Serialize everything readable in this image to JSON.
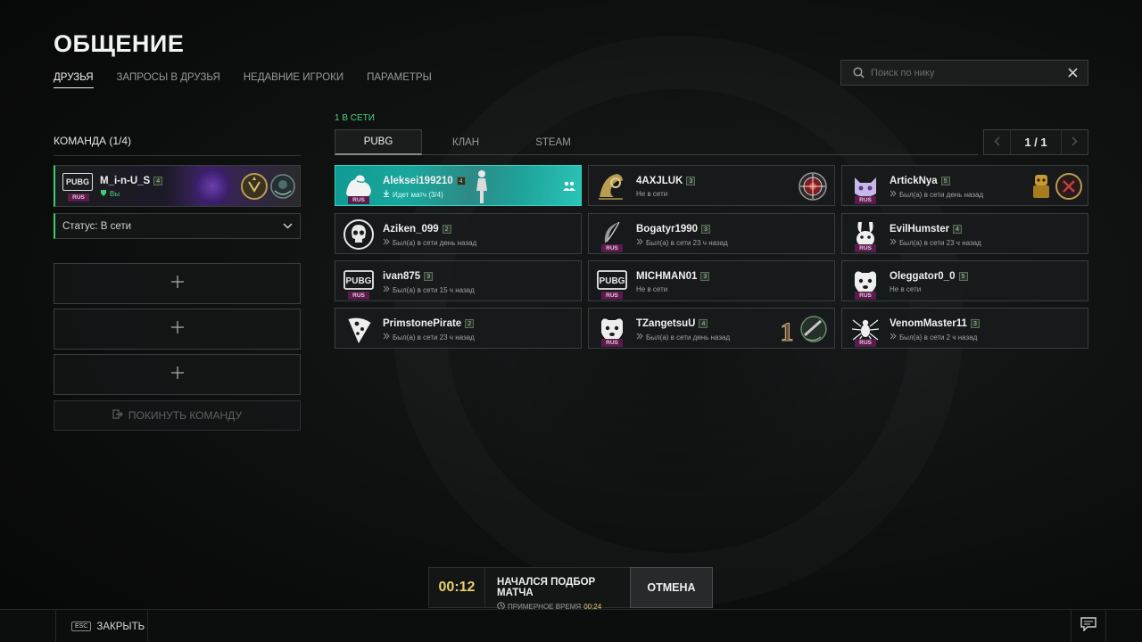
{
  "header": {
    "title": "ОБЩЕНИЕ",
    "tabs": [
      "ДРУЗЬЯ",
      "ЗАПРОСЫ В ДРУЗЬЯ",
      "НЕДАВНИЕ ИГРОКИ",
      "ПАРАМЕТРЫ"
    ],
    "active_tab": "ДРУЗЬЯ"
  },
  "search": {
    "placeholder": "Поиск по нику"
  },
  "team": {
    "title": "КОМАНДА (1/4)",
    "member": {
      "name": "M_i-n-U_S",
      "level": "4",
      "tag": "Вы",
      "avatar_text": "PUBG",
      "region": "RUS"
    },
    "status_label": "Статус: В сети",
    "empty_slots": 3,
    "leave_label": "ПОКИНУТЬ КОМАНДУ"
  },
  "friends": {
    "online_count": "1 В СЕТИ",
    "tabs": [
      "PUBG",
      "КЛАН",
      "STEAM"
    ],
    "active_tab": "PUBG",
    "page": "1 / 1",
    "list": [
      {
        "name": "Aleksei199210",
        "level": "4",
        "status": "Идет матч (3/4)",
        "avatar": "muscle-icon",
        "region": "RUS",
        "highlight": true
      },
      {
        "name": "4AXJLUK",
        "level": "3",
        "status": "Не в сети",
        "avatar": "chicken-badge-icon",
        "region": "",
        "highlight": false
      },
      {
        "name": "ArtickNya",
        "level": "5",
        "status": "Был(а) в сети день назад",
        "avatar": "cat-icon",
        "region": "RUS",
        "highlight": false
      },
      {
        "name": "Aziken_099",
        "level": "2",
        "status": "Был(а) в сети день назад",
        "avatar": "skull-icon",
        "region": "",
        "highlight": false
      },
      {
        "name": "Bogatyr1990",
        "level": "3",
        "status": "Был(а) в сети 23 ч назад",
        "avatar": "feather-icon",
        "region": "RUS",
        "highlight": false
      },
      {
        "name": "EvilHumster",
        "level": "4",
        "status": "Был(а) в сети 23 ч назад",
        "avatar": "rabbit-icon",
        "region": "RUS",
        "highlight": false
      },
      {
        "name": "ivan875",
        "level": "3",
        "status": "Был(а) в сети 15 ч назад",
        "avatar": "pubg-icon",
        "region": "RUS",
        "highlight": false
      },
      {
        "name": "MICHMAN01",
        "level": "3",
        "status": "Не в сети",
        "avatar": "pubg-icon",
        "region": "RUS",
        "highlight": false
      },
      {
        "name": "Oleggator0_0",
        "level": "5",
        "status": "Не в сети",
        "avatar": "dog-icon",
        "region": "RUS",
        "highlight": false
      },
      {
        "name": "PrimstonePirate",
        "level": "2",
        "status": "Был(а) в сети 23 ч назад",
        "avatar": "pizza-icon",
        "region": "",
        "highlight": false
      },
      {
        "name": "TZangetsuU",
        "level": "4",
        "status": "Был(а) в сети день назад",
        "avatar": "dog-icon",
        "region": "RUS",
        "highlight": false
      },
      {
        "name": "VenomMaster11",
        "level": "3",
        "status": "Был(а) в сети 2 ч назад",
        "avatar": "spider-icon",
        "region": "RUS",
        "highlight": false
      }
    ]
  },
  "matchmaking": {
    "timer": "00:12",
    "title": "НАЧАЛСЯ ПОДБОР МАТЧА",
    "estimate_label": "ПРИМЕРНОЕ ВРЕМЯ",
    "estimate_time": "00:24",
    "cancel_label": "ОТМЕНА"
  },
  "footer": {
    "esc_key": "ESC",
    "close_label": "ЗАКРЫТЬ"
  },
  "colors": {
    "online_green": "#3ccf6e",
    "highlight_teal": "#1aa79c",
    "timer_yellow": "#e8d06a",
    "region_purple": "#5a1c4a"
  }
}
